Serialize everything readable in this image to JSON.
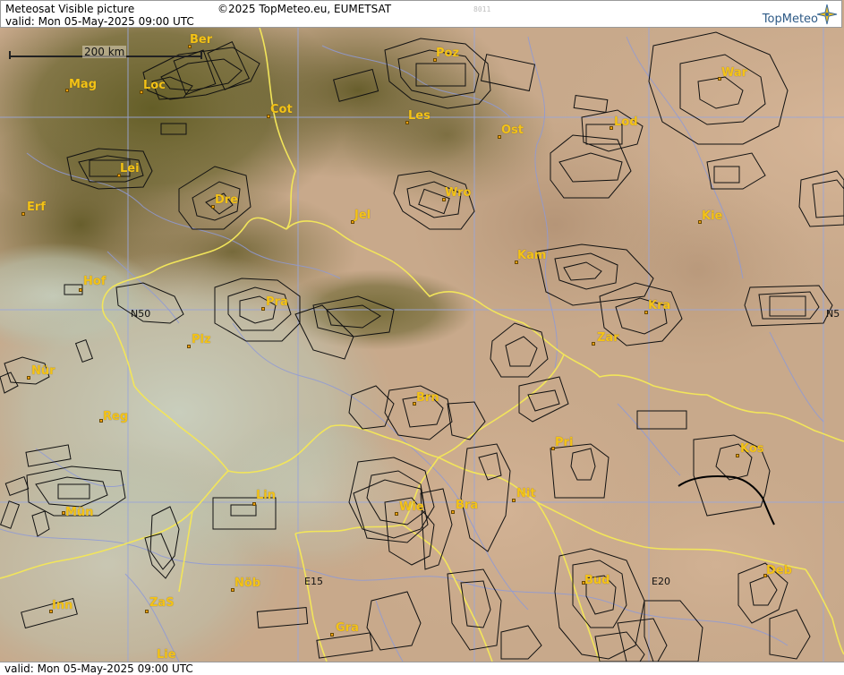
{
  "header": {
    "title": "Meteosat Visible picture",
    "copyright": "©2025 TopMeteo.eu, EUMETSAT",
    "valid": "valid:  Mon  05-May-2025  09:00 UTC",
    "code": "8011",
    "brand": "TopMeteo"
  },
  "footer": {
    "valid": "valid:  Mon  05-May-2025  09:00 UTC"
  },
  "map": {
    "scale_label": "200 km",
    "grid_labels": {
      "n50_west": "N50",
      "n50_east": "N5",
      "e15": "E15",
      "e20": "E20"
    },
    "cities": {
      "ber": "Ber",
      "poz": "Poz",
      "mag": "Mag",
      "loc": "Loc",
      "cot": "Cot",
      "les": "Les",
      "ost": "Ost",
      "lod": "Lod",
      "war": "War",
      "lei": "Lei",
      "dre": "Dre",
      "wro": "Wro",
      "erf": "Erf",
      "jel": "Jel",
      "kie": "Kie",
      "kam": "Kam",
      "hof": "Hof",
      "pra": "Pra",
      "kra": "Kra",
      "zar": "Zar",
      "plz": "Plz",
      "nur": "Nür",
      "brn": "Brn",
      "reg": "Reg",
      "pri": "Pri",
      "kos": "Kos",
      "lin": "Lin",
      "nit": "Nit",
      "wie": "Wie",
      "bra": "Bra",
      "mun": "Mün",
      "bud": "Bud",
      "deb": "Deb",
      "nob": "Nöb",
      "inn": "Inn",
      "zas": "ZaS",
      "gra": "Gra",
      "lie": "Lie"
    },
    "colors": {
      "border": "#f2e55a",
      "river": "#8f9ad6",
      "grid": "#9aa6d8",
      "outline": "#111111",
      "city_text": "#f4c316"
    }
  }
}
